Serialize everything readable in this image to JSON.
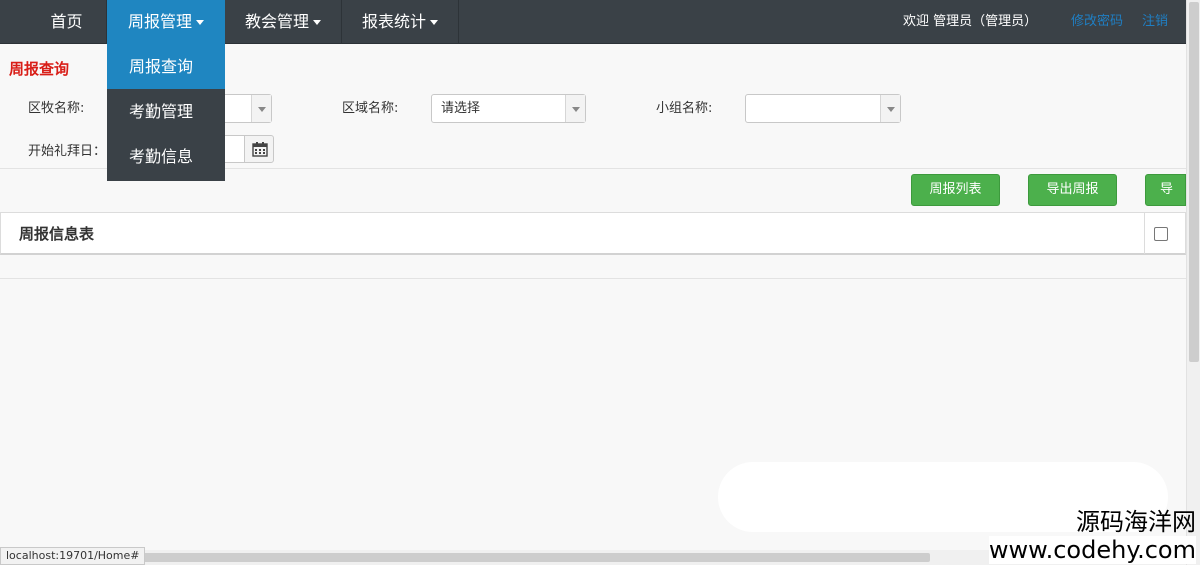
{
  "nav": {
    "items": [
      {
        "label": "首页",
        "has_caret": false
      },
      {
        "label": "周报管理",
        "has_caret": true,
        "active": true
      },
      {
        "label": "教会管理",
        "has_caret": true
      },
      {
        "label": "报表统计",
        "has_caret": true
      }
    ],
    "welcome": "欢迎 管理员（管理员）",
    "change_password": "修改密码",
    "logout": "注销"
  },
  "dropdown": {
    "items": [
      {
        "label": "周报查询",
        "active": true
      },
      {
        "label": "考勤管理"
      },
      {
        "label": "考勤信息"
      }
    ]
  },
  "page": {
    "title": "周报查询"
  },
  "filters": {
    "campus_label": "区牧名称:",
    "region_label": "区域名称:",
    "region_value": "请选择",
    "group_label": "小组名称:",
    "group_value": "",
    "start_date_label": "开始礼拜日："
  },
  "buttons": {
    "weekly_list": "周报列表",
    "export_weekly": "导出周报",
    "export_more": "导出"
  },
  "table": {
    "title": "周报信息表"
  },
  "status_bar": {
    "url": "localhost:19701/Home#"
  },
  "watermark": {
    "line1": "源码海洋网",
    "line2": "www.codehy.com"
  },
  "colors": {
    "nav_bg": "#3a4147",
    "accent": "#1f86c1",
    "title_red": "#d91e18",
    "button_green": "#4cb04c"
  }
}
